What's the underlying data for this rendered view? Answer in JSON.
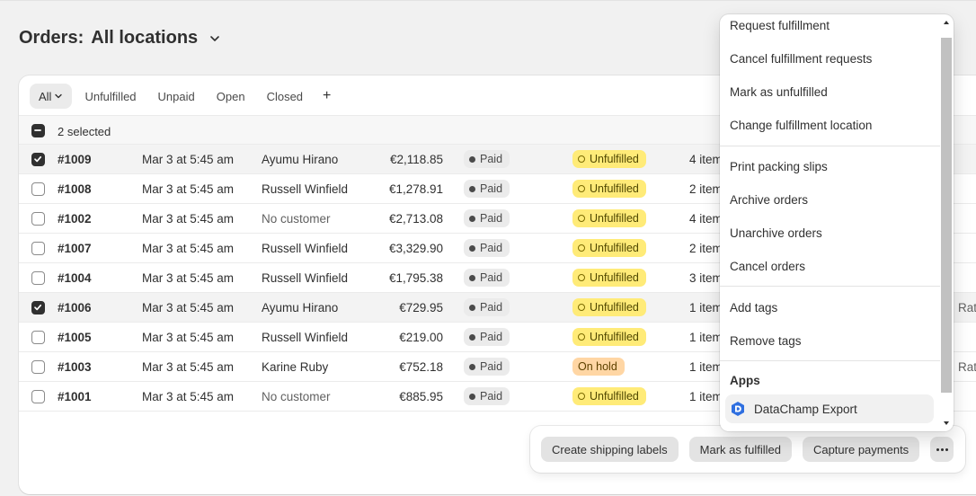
{
  "header": {
    "title": "Orders:",
    "location": "All locations"
  },
  "tabs": [
    {
      "label": "All"
    },
    {
      "label": "Unfulfilled"
    },
    {
      "label": "Unpaid"
    },
    {
      "label": "Open"
    },
    {
      "label": "Closed"
    },
    {
      "label": "+"
    }
  ],
  "selection": {
    "count_label": "2 selected"
  },
  "orders": [
    {
      "id": "#1009",
      "date": "Mar 3 at 5:45 am",
      "customer": "Ayumu Hirano",
      "total": "€2,118.85",
      "payment": "Paid",
      "fulfillment": "Unfulfilled",
      "items": "4 item",
      "extra": "",
      "checked": true
    },
    {
      "id": "#1008",
      "date": "Mar 3 at 5:45 am",
      "customer": "Russell Winfield",
      "total": "€1,278.91",
      "payment": "Paid",
      "fulfillment": "Unfulfilled",
      "items": "2 item",
      "extra": "",
      "checked": false
    },
    {
      "id": "#1002",
      "date": "Mar 3 at 5:45 am",
      "customer": "No customer",
      "total": "€2,713.08",
      "payment": "Paid",
      "fulfillment": "Unfulfilled",
      "items": "4 item",
      "extra": "",
      "checked": false
    },
    {
      "id": "#1007",
      "date": "Mar 3 at 5:45 am",
      "customer": "Russell Winfield",
      "total": "€3,329.90",
      "payment": "Paid",
      "fulfillment": "Unfulfilled",
      "items": "2 item",
      "extra": "",
      "checked": false
    },
    {
      "id": "#1004",
      "date": "Mar 3 at 5:45 am",
      "customer": "Russell Winfield",
      "total": "€1,795.38",
      "payment": "Paid",
      "fulfillment": "Unfulfilled",
      "items": "3 item",
      "extra": "",
      "checked": false
    },
    {
      "id": "#1006",
      "date": "Mar 3 at 5:45 am",
      "customer": "Ayumu Hirano",
      "total": "€729.95",
      "payment": "Paid",
      "fulfillment": "Unfulfilled",
      "items": "1 item",
      "extra": "Rat",
      "checked": true
    },
    {
      "id": "#1005",
      "date": "Mar 3 at 5:45 am",
      "customer": "Russell Winfield",
      "total": "€219.00",
      "payment": "Paid",
      "fulfillment": "Unfulfilled",
      "items": "1 item",
      "extra": "",
      "checked": false
    },
    {
      "id": "#1003",
      "date": "Mar 3 at 5:45 am",
      "customer": "Karine Ruby",
      "total": "€752.18",
      "payment": "Paid",
      "fulfillment": "On hold",
      "items": "1 item",
      "extra": "Rate",
      "checked": false
    },
    {
      "id": "#1001",
      "date": "Mar 3 at 5:45 am",
      "customer": "No customer",
      "total": "€885.95",
      "payment": "Paid",
      "fulfillment": "Unfulfilled",
      "items": "1 item",
      "extra": "",
      "checked": false
    }
  ],
  "actions": {
    "create_labels": "Create shipping labels",
    "mark_fulfilled": "Mark as fulfilled",
    "capture_payments": "Capture payments"
  },
  "menu": {
    "group1": [
      "Request fulfillment",
      "Cancel fulfillment requests",
      "Mark as unfulfilled",
      "Change fulfillment location"
    ],
    "group2": [
      "Print packing slips",
      "Archive orders",
      "Unarchive orders",
      "Cancel orders"
    ],
    "group3": [
      "Add tags",
      "Remove tags"
    ],
    "apps_title": "Apps",
    "app_item": "DataChamp Export"
  },
  "colors": {
    "unfulfilled_badge": "#ffeb78",
    "onhold_badge": "#ffd6a4",
    "paid_badge": "#ebebeb"
  }
}
